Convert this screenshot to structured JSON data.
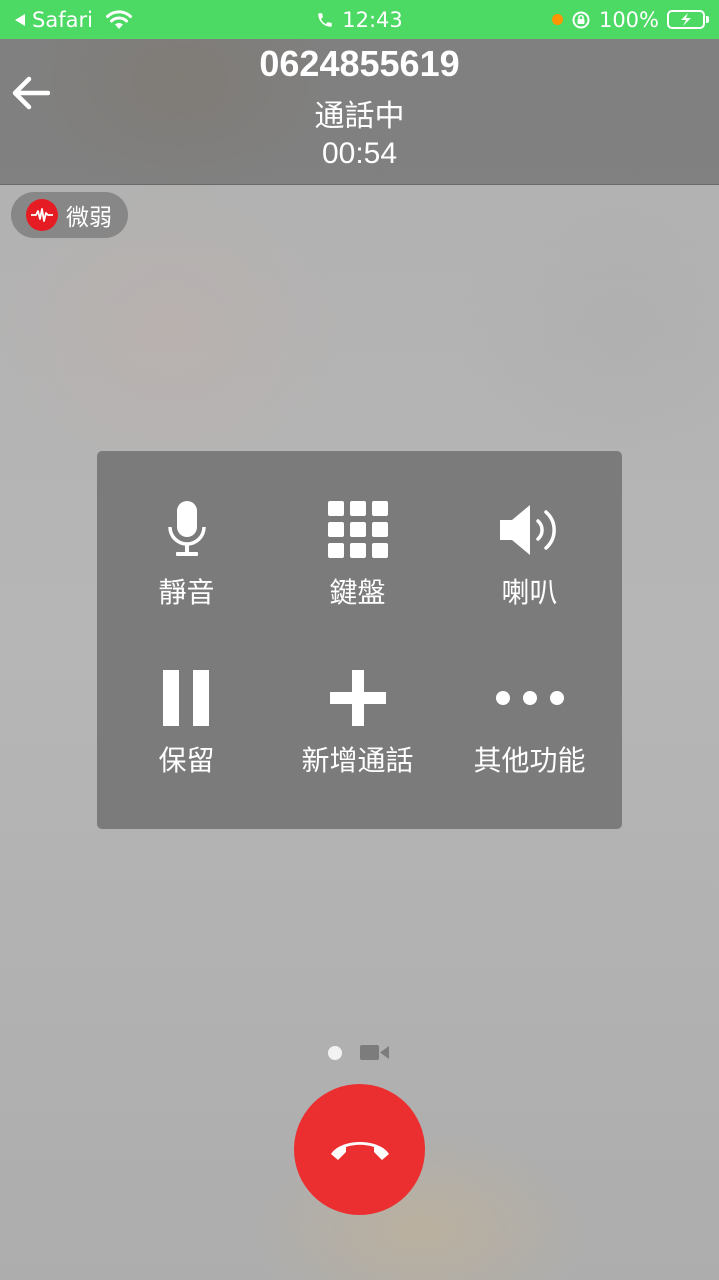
{
  "status_bar": {
    "back_app": "Safari",
    "time": "12:43",
    "battery": "100%"
  },
  "call": {
    "number": "0624855619",
    "status": "通話中",
    "timer": "00:54"
  },
  "signal": {
    "label": "微弱",
    "color": "#e51c23"
  },
  "controls": [
    {
      "label": "靜音",
      "icon": "microphone-icon"
    },
    {
      "label": "鍵盤",
      "icon": "keypad-icon"
    },
    {
      "label": "喇叭",
      "icon": "speaker-icon"
    },
    {
      "label": "保留",
      "icon": "pause-icon"
    },
    {
      "label": "新增通話",
      "icon": "plus-icon"
    },
    {
      "label": "其他功能",
      "icon": "more-icon"
    }
  ],
  "colors": {
    "status_bar": "#4cd964",
    "end_call": "#eb2f30",
    "panel": "#7b7b7b"
  }
}
